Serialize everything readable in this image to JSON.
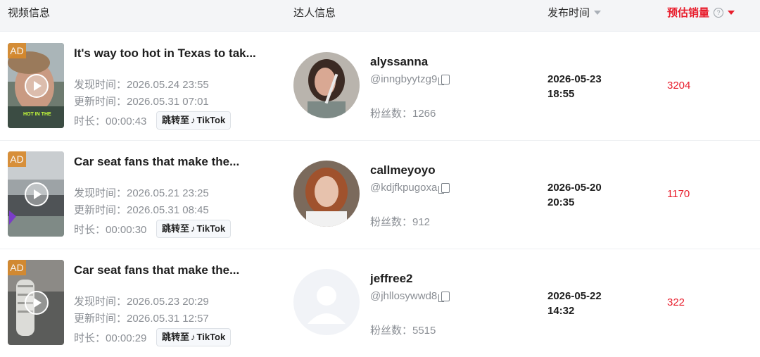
{
  "header": {
    "video_info": "视频信息",
    "creator_info": "达人信息",
    "publish_time": "发布时间",
    "est_sales": "预估销量",
    "help_icon": "?"
  },
  "common": {
    "ad_badge": "AD",
    "jump_to": "跳转至",
    "tiktok": "TikTok",
    "sales_sort_color": "#e81d2c"
  },
  "rows": [
    {
      "title": "It's way too hot in Texas to tak...",
      "found": "发现时间：2026.05.24 23:55",
      "updated": "更新时间：2026.05.31 07:01",
      "duration": "时长：00:00:43",
      "overlay_caption": "HOT IN THE",
      "creator_name": "alyssanna",
      "handle": "@inngbyytzg9",
      "fans": "粉丝数：1266",
      "pub_date": "2026-05-23",
      "pub_time": "18:55",
      "sales": "3204"
    },
    {
      "title": "Car seat fans that make the...",
      "found": "发现时间：2026.05.21 23:25",
      "updated": "更新时间：2026.05.31 08:45",
      "duration": "时长：00:00:30",
      "creator_name": "callmeyoyo",
      "handle": "@kdjfkpugoxa",
      "fans": "粉丝数：912",
      "pub_date": "2026-05-20",
      "pub_time": "20:35",
      "sales": "1170"
    },
    {
      "title": "Car seat fans that make the...",
      "found": "发现时间：2026.05.23 20:29",
      "updated": "更新时间：2026.05.31 12:57",
      "duration": "时长：00:00:29",
      "creator_name": "jeffree2",
      "handle": "@jhllosywwd8",
      "fans": "粉丝数：5515",
      "pub_date": "2026-05-22",
      "pub_time": "14:32",
      "sales": "322"
    }
  ]
}
